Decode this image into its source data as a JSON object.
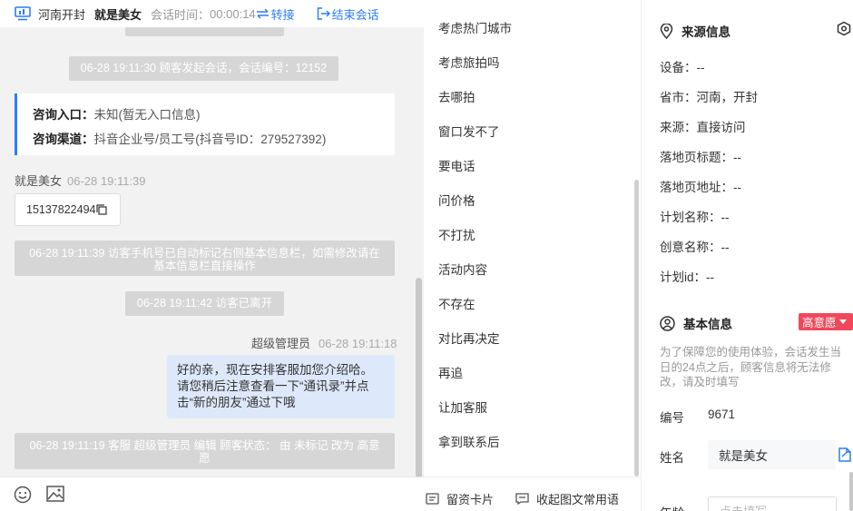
{
  "header": {
    "location": "河南开封",
    "visitor_name": "就是美女",
    "session_time_label": "会话时间：",
    "session_time_value": "00:00:14",
    "transfer_label": "转接",
    "end_label": "结束会话"
  },
  "messages": {
    "session_start": "06-28 19:11:30 顾客发起会话，会话编号：12152",
    "entry_label": "咨询入口：",
    "entry_value": "未知(暂无入口信息)",
    "channel_label": "咨询渠道：",
    "channel_value": "抖音企业号/员工号(抖音号ID：279527392)",
    "visitor_name": "就是美女",
    "visitor_time": "06-28 19:11:39",
    "phone": "15137822494",
    "auto_mark": "06-28 19:11:39 访客手机号已自动标记右侧基本信息栏，如需修改请在基本信息栏直接操作",
    "left_notice": "06-28 19:11:42 访客已离开",
    "agent_name": "超级管理员",
    "agent_time": "06-28 19:11:18",
    "agent_message": "好的亲，现在安排客服加您介绍哈。请您稍后注意查看一下“通讯录”并点击“新的朋友”通过下哦",
    "status_change": "06-28 19:11:19 客服 超级管理员 编辑 顾客状态： 由 未标记 改为 高意愿"
  },
  "phrases": {
    "items": [
      "考虑热门城市",
      "考虑旅拍吗",
      "去哪拍",
      "窗口发不了",
      "要电话",
      "问价格",
      "不打扰",
      "活动内容",
      "不存在",
      "对比再决定",
      "再追",
      "让加客服",
      "拿到联系后"
    ],
    "footer_card": "留资卡片",
    "footer_collapse": "收起图文常用语"
  },
  "info": {
    "source_title": "来源信息",
    "device": "设备：--",
    "province": "省市：河南，开封",
    "source": "来源：直接访问",
    "landing_title": "落地页标题：--",
    "landing_url": "落地页地址：--",
    "plan_name": "计划名称：--",
    "creative_name": "创意名称：--",
    "plan_id": "计划id：--",
    "basic_title": "基本信息",
    "intent_badge": "高意愿",
    "notice": "为了保障您的使用体验，会话发生当日的24点之后，顾客信息将无法修改，请及时填写",
    "number_label": "编号",
    "number_value": "9671",
    "name_label": "姓名",
    "name_value": "就是美女",
    "age_label": "年龄",
    "age_placeholder": "点击填写"
  },
  "colors": {
    "accent": "#2b7cf6",
    "badge": "#f0485a",
    "system_msg": "#d6d6d6",
    "agent_bubble": "#dde9fb"
  }
}
